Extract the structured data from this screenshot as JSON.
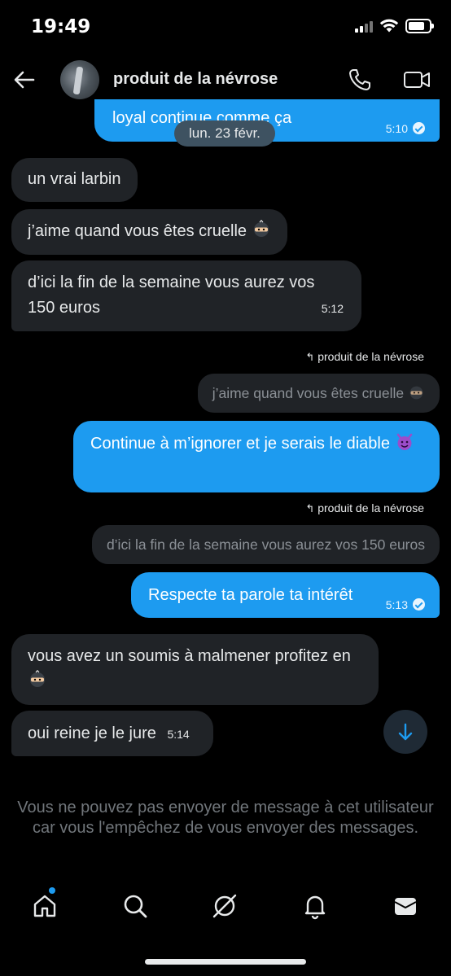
{
  "status_bar": {
    "time": "19:49"
  },
  "header": {
    "contact_name": "produit de la névrose"
  },
  "date_separator": "lun. 23 févr.",
  "messages": [
    {
      "side": "out",
      "text": "loyal continue comme ça",
      "time": "5:10",
      "read": true
    },
    {
      "side": "in",
      "text": "un vrai larbin"
    },
    {
      "side": "in",
      "text": "j’aime quand vous êtes cruelle",
      "emoji": "ninja-emoji"
    },
    {
      "side": "in",
      "text": "d’ici la fin de la semaine vous aurez vos 150 euros",
      "time": "5:12"
    },
    {
      "side": "out",
      "reply_to_author": "produit de la névrose",
      "reply_to_text": "j’aime quand vous êtes cruelle",
      "text": "Continue à m’ignorer et je serais le diable",
      "emoji": "smiling-devil-emoji"
    },
    {
      "side": "out",
      "reply_to_author": "produit de la névrose",
      "reply_to_text": "d’ici la fin de la semaine vous aurez vos 150 euros",
      "text": "Respecte ta parole ta intérêt",
      "time": "5:13",
      "read": true
    },
    {
      "side": "in",
      "text": "vous avez un soumis à malmener profitez en",
      "emoji": "ninja-emoji"
    },
    {
      "side": "in",
      "text": "oui reine je le jure",
      "time": "5:14"
    }
  ],
  "blocked_notice": "Vous ne pouvez pas envoyer de message à cet utilisateur car vous l'empêchez de vous envoyer des messages.",
  "tab_bar": [
    "home-icon",
    "search-icon",
    "grok-icon",
    "notifications-icon",
    "messages-icon"
  ],
  "colors": {
    "accent": "#1d9bf0",
    "incoming_bubble": "#202327",
    "muted_text": "#71767b",
    "background": "#000000"
  }
}
